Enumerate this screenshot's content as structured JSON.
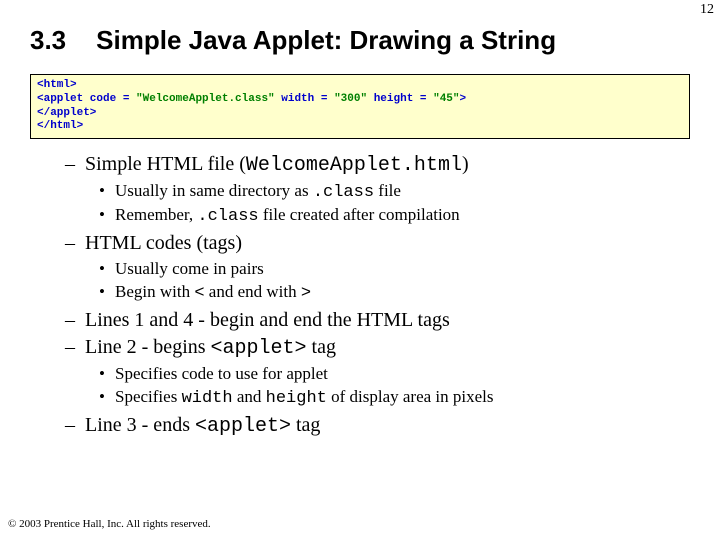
{
  "pageNumber": "12",
  "section": {
    "number": "3.3",
    "title": "Simple Java Applet: Drawing a String"
  },
  "code": {
    "l1a": "<html>",
    "l2a": "<applet code = ",
    "l2b": "\"WelcomeApplet.class\"",
    "l2c": " width = ",
    "l2d": "\"300\"",
    "l2e": " height = ",
    "l2f": "\"45\"",
    "l2g": ">",
    "l3a": "</applet>",
    "l4a": "</html>"
  },
  "bullets": {
    "b1a": "Simple HTML file (",
    "b1b": "WelcomeApplet.html",
    "b1c": ")",
    "b1_1a": "Usually in same directory as ",
    "b1_1b": ".class",
    "b1_1c": " file",
    "b1_2a": "Remember, ",
    "b1_2b": ".class",
    "b1_2c": " file created after compilation",
    "b2": "HTML codes (tags)",
    "b2_1": "Usually come in pairs",
    "b2_2a": "Begin with ",
    "b2_2b": "<",
    "b2_2c": " and end with ",
    "b2_2d": ">",
    "b3": "Lines 1 and 4 - begin and end the HTML tags",
    "b4a": "Line 2 - begins ",
    "b4b": "<applet>",
    "b4c": " tag",
    "b4_1": "Specifies code to use for applet",
    "b4_2a": "Specifies ",
    "b4_2b": "width",
    "b4_2c": " and ",
    "b4_2d": "height",
    "b4_2e": " of display area in pixels",
    "b5a": "Line 3 - ends ",
    "b5b": "<applet>",
    "b5c": " tag"
  },
  "footer": "© 2003 Prentice Hall, Inc. All rights reserved."
}
